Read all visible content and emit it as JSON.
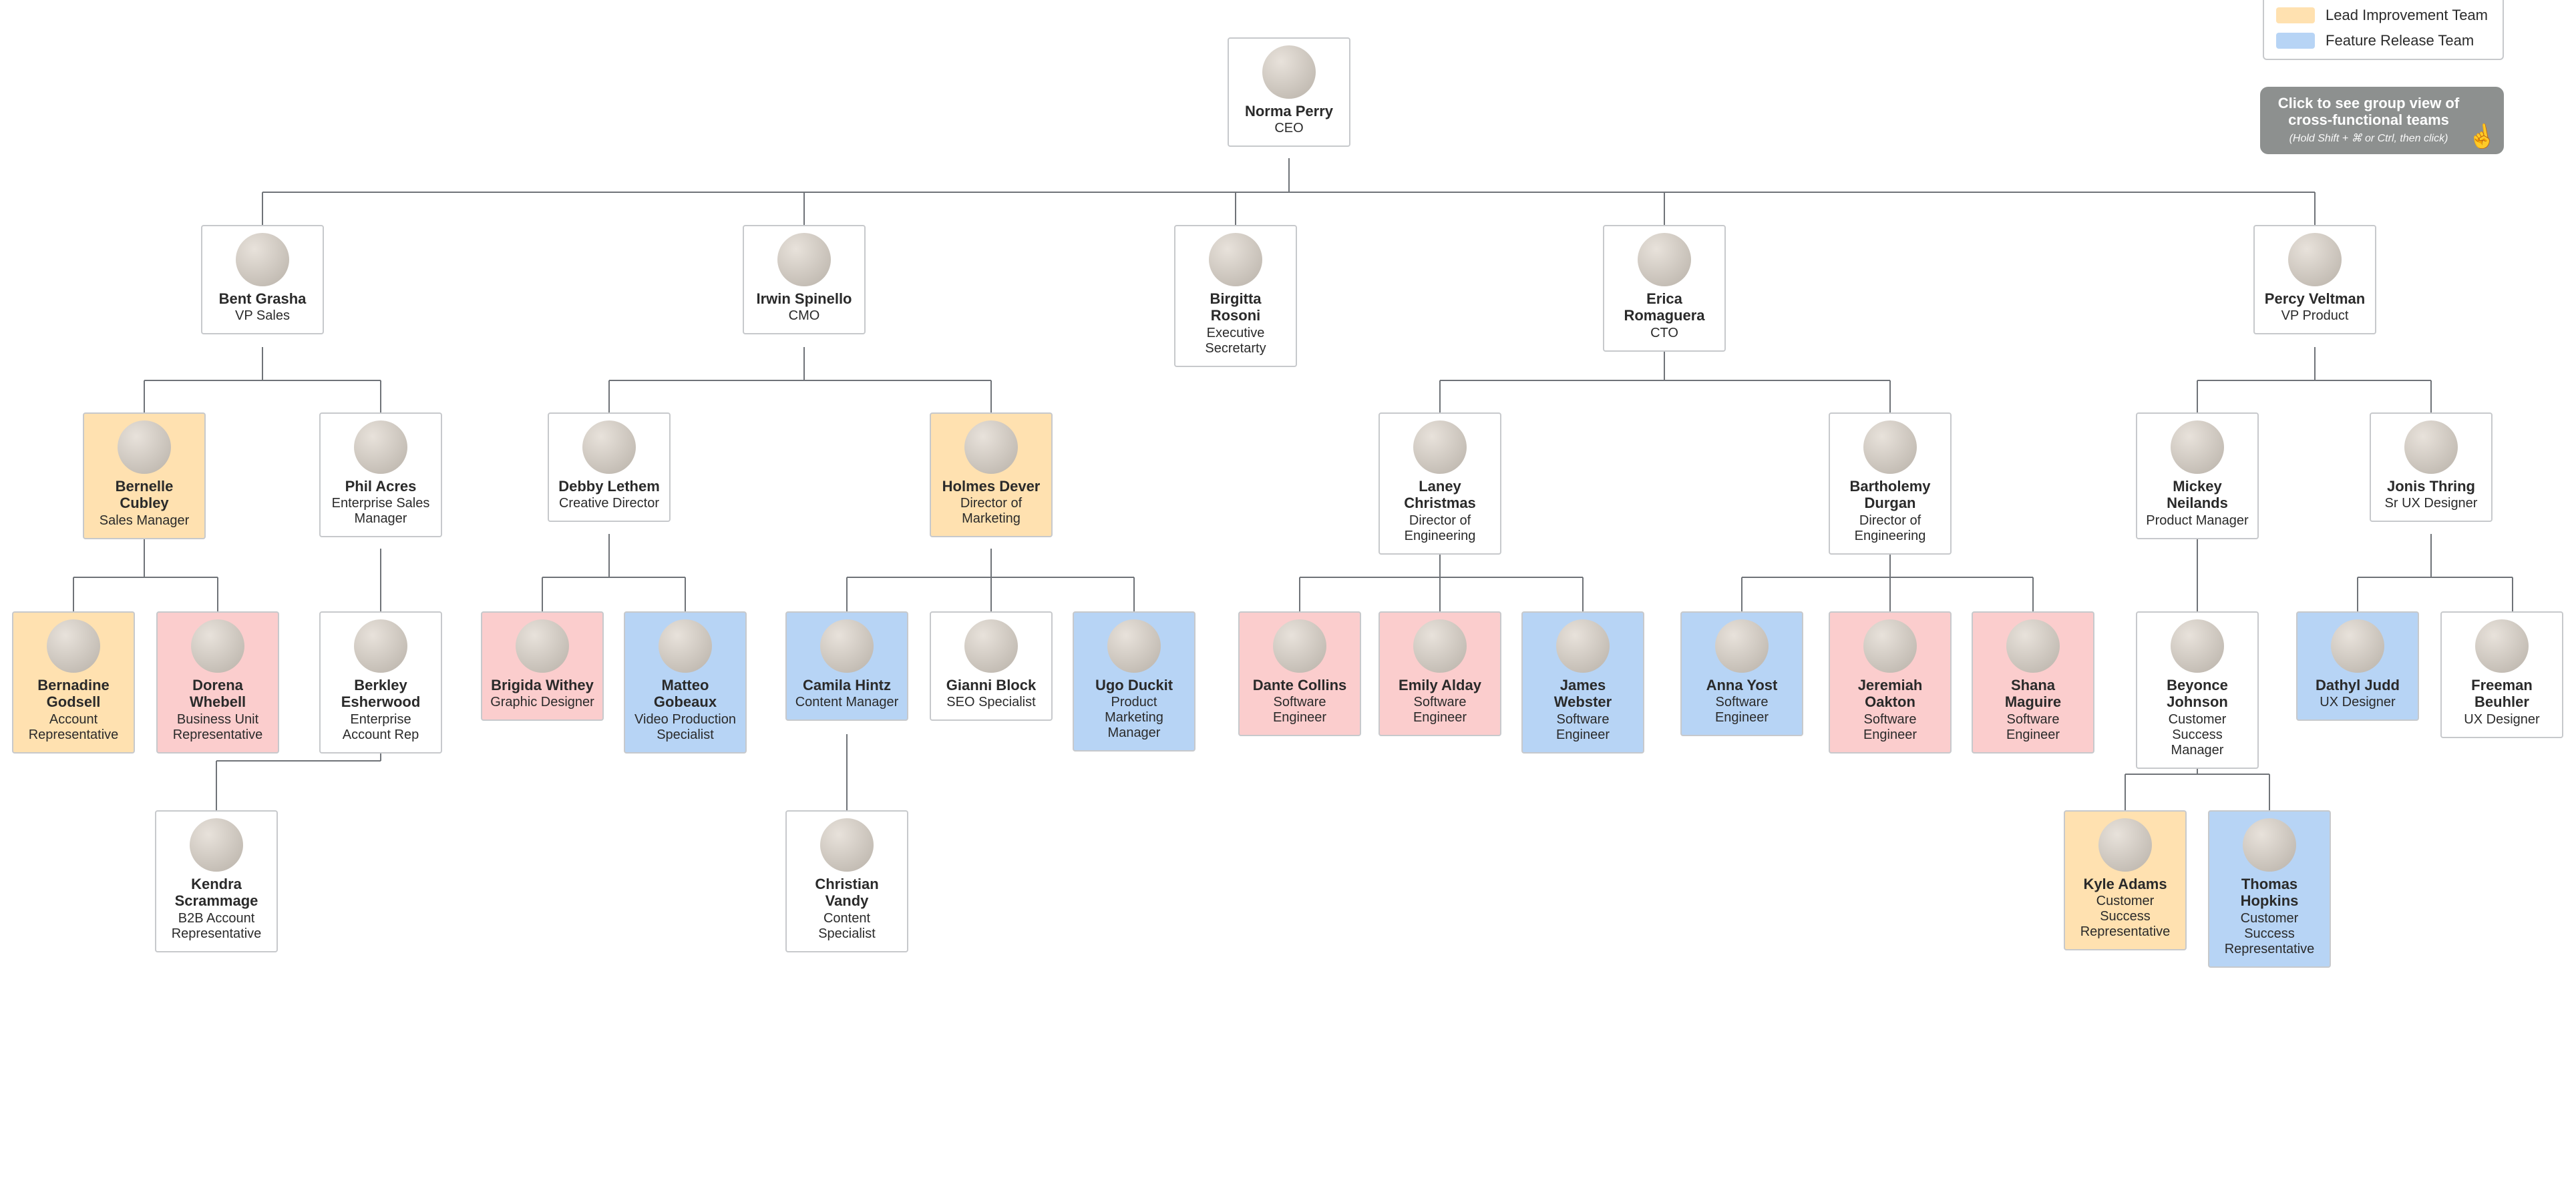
{
  "legend": {
    "lead_team": "Lead Improvement Team",
    "feature_team": "Feature Release Team"
  },
  "cta": {
    "line1": "Click to see group view of",
    "line2": "cross-functional teams",
    "hint": "(Hold Shift + ⌘ or Ctrl, then click)"
  },
  "chart_data": {
    "type": "org-chart",
    "color_legend": {
      "orange": "Lead Improvement Team",
      "blue": "Feature Release Team",
      "pink": "(unlabeled group)"
    },
    "root": {
      "name": "Norma Perry",
      "title": "CEO",
      "children": [
        {
          "name": "Bent Grasha",
          "title": "VP Sales",
          "children": [
            {
              "name": "Bernelle Cubley",
              "title": "Sales Manager",
              "team": "orange",
              "children": [
                {
                  "name": "Bernadine Godsell",
                  "title": "Account Representative",
                  "team": "orange"
                },
                {
                  "name": "Dorena Whebell",
                  "title": "Business Unit Representative",
                  "team": "pink"
                }
              ]
            },
            {
              "name": "Phil Acres",
              "title": "Enterprise Sales Manager",
              "children": [
                {
                  "name": "Berkley Esherwood",
                  "title": "Enterprise Account Rep",
                  "children": [
                    {
                      "name": "Kendra Scrammage",
                      "title": "B2B Account Representative"
                    }
                  ]
                }
              ]
            }
          ]
        },
        {
          "name": "Irwin Spinello",
          "title": "CMO",
          "children": [
            {
              "name": "Debby Lethem",
              "title": "Creative Director",
              "children": [
                {
                  "name": "Brigida Withey",
                  "title": "Graphic Designer",
                  "team": "pink"
                },
                {
                  "name": "Matteo Gobeaux",
                  "title": "Video Production Specialist",
                  "team": "blue"
                }
              ]
            },
            {
              "name": "Holmes Dever",
              "title": "Director of Marketing",
              "team": "orange",
              "children": [
                {
                  "name": "Camila Hintz",
                  "title": "Content Manager",
                  "team": "blue",
                  "children": [
                    {
                      "name": "Christian Vandy",
                      "title": "Content Specialist"
                    }
                  ]
                },
                {
                  "name": "Gianni Block",
                  "title": "SEO Specialist"
                },
                {
                  "name": "Ugo Duckit",
                  "title": "Product Marketing Manager",
                  "team": "blue"
                }
              ]
            }
          ]
        },
        {
          "name": "Birgitta Rosoni",
          "title": "Executive Secretarty"
        },
        {
          "name": "Erica Romaguera",
          "title": "CTO",
          "children": [
            {
              "name": "Laney Christmas",
              "title": "Director of Engineering",
              "children": [
                {
                  "name": "Dante Collins",
                  "title": "Software Engineer",
                  "team": "pink"
                },
                {
                  "name": "Emily Alday",
                  "title": "Software Engineer",
                  "team": "pink"
                },
                {
                  "name": "James Webster",
                  "title": "Software Engineer",
                  "team": "blue"
                }
              ]
            },
            {
              "name": "Bartholemy Durgan",
              "title": "Director of Engineering",
              "children": [
                {
                  "name": "Anna Yost",
                  "title": "Software Engineer",
                  "team": "blue"
                },
                {
                  "name": "Jeremiah Oakton",
                  "title": "Software Engineer",
                  "team": "pink"
                },
                {
                  "name": "Shana Maguire",
                  "title": "Software Engineer",
                  "team": "pink"
                }
              ]
            }
          ]
        },
        {
          "name": "Percy Veltman",
          "title": "VP Product",
          "children": [
            {
              "name": "Mickey Neilands",
              "title": "Product Manager",
              "children": [
                {
                  "name": "Beyonce Johnson",
                  "title": "Customer Success Manager",
                  "children": [
                    {
                      "name": "Kyle Adams",
                      "title": "Customer Success Representative",
                      "team": "orange"
                    },
                    {
                      "name": "Thomas Hopkins",
                      "title": "Customer Success Representative",
                      "team": "blue"
                    }
                  ]
                }
              ]
            },
            {
              "name": "Jonis Thring",
              "title": "Sr UX Designer",
              "children": [
                {
                  "name": "Dathyl Judd",
                  "title": "UX Designer",
                  "team": "blue"
                },
                {
                  "name": "Freeman Beuhler",
                  "title": "UX Designer"
                }
              ]
            }
          ]
        }
      ]
    }
  },
  "nodes": {
    "norma": {
      "name": "Norma Perry",
      "title": "CEO"
    },
    "bent": {
      "name": "Bent Grasha",
      "title": "VP Sales"
    },
    "irwin": {
      "name": "Irwin Spinello",
      "title": "CMO"
    },
    "birgitta": {
      "name": "Birgitta Rosoni",
      "title": "Executive Secretarty"
    },
    "erica": {
      "name": "Erica Romaguera",
      "title": "CTO"
    },
    "percy": {
      "name": "Percy Veltman",
      "title": "VP Product"
    },
    "bernelle": {
      "name": "Bernelle Cubley",
      "title": "Sales Manager"
    },
    "phil": {
      "name": "Phil Acres",
      "title": "Enterprise Sales Manager"
    },
    "debby": {
      "name": "Debby Lethem",
      "title": "Creative Director"
    },
    "holmes": {
      "name": "Holmes Dever",
      "title": "Director of Marketing"
    },
    "laney": {
      "name": "Laney Christmas",
      "title": "Director of Engineering"
    },
    "barth": {
      "name": "Bartholemy Durgan",
      "title": "Director of Engineering"
    },
    "mickey": {
      "name": "Mickey Neilands",
      "title": "Product Manager"
    },
    "jonis": {
      "name": "Jonis Thring",
      "title": "Sr UX Designer"
    },
    "bernadine": {
      "name": "Bernadine Godsell",
      "title": "Account Representative"
    },
    "dorena": {
      "name": "Dorena Whebell",
      "title": "Business Unit Representative"
    },
    "berkley": {
      "name": "Berkley Esherwood",
      "title": "Enterprise Account Rep"
    },
    "kendra": {
      "name": "Kendra Scrammage",
      "title": "B2B Account Representative"
    },
    "brigida": {
      "name": "Brigida Withey",
      "title": "Graphic Designer"
    },
    "matteo": {
      "name": "Matteo Gobeaux",
      "title": "Video Production Specialist"
    },
    "camila": {
      "name": "Camila Hintz",
      "title": "Content Manager"
    },
    "gianni": {
      "name": "Gianni Block",
      "title": "SEO Specialist"
    },
    "ugo": {
      "name": "Ugo Duckit",
      "title": "Product Marketing Manager"
    },
    "christian": {
      "name": "Christian Vandy",
      "title": "Content Specialist"
    },
    "dante": {
      "name": "Dante Collins",
      "title": "Software Engineer"
    },
    "emily": {
      "name": "Emily Alday",
      "title": "Software Engineer"
    },
    "james": {
      "name": "James Webster",
      "title": "Software Engineer"
    },
    "anna": {
      "name": "Anna Yost",
      "title": "Software Engineer"
    },
    "jeremiah": {
      "name": "Jeremiah Oakton",
      "title": "Software Engineer"
    },
    "shana": {
      "name": "Shana Maguire",
      "title": "Software Engineer"
    },
    "beyonce": {
      "name": "Beyonce Johnson",
      "title": "Customer Success Manager"
    },
    "dathyl": {
      "name": "Dathyl Judd",
      "title": "UX Designer"
    },
    "freeman": {
      "name": "Freeman Beuhler",
      "title": "UX Designer"
    },
    "kyle": {
      "name": "Kyle Adams",
      "title": "Customer Success Representative"
    },
    "thomas": {
      "name": "Thomas Hopkins",
      "title": "Customer Success Representative"
    }
  }
}
